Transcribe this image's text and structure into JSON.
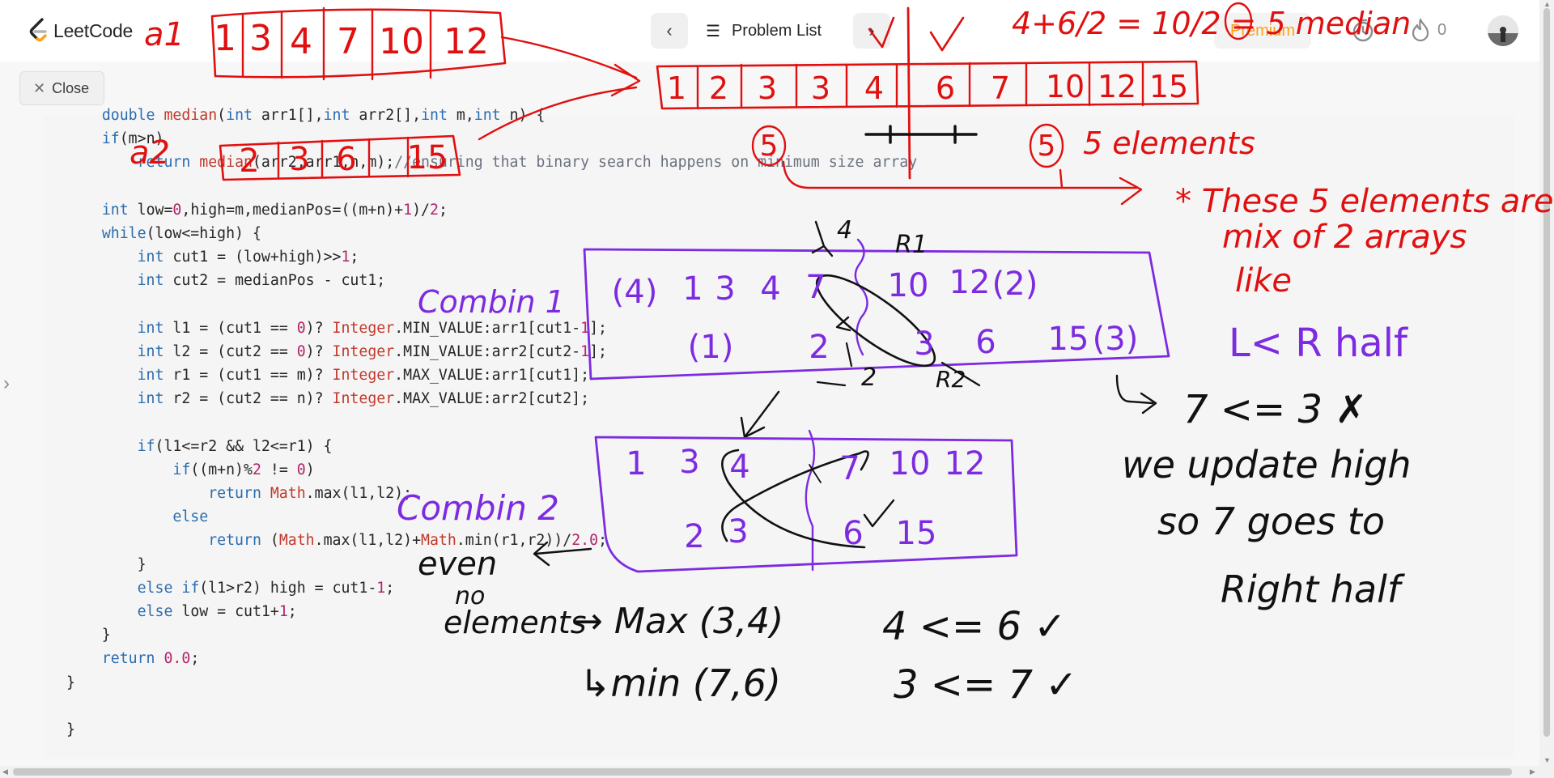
{
  "brand": {
    "name": "LeetCode"
  },
  "nav": {
    "prev_label": "‹",
    "problem_list_label": "Problem List",
    "next_label": "›",
    "premium_label": "Premium",
    "streak_count": "0"
  },
  "subbar": {
    "close_label": "Close"
  },
  "code_lines": [
    "    double median(int arr1[],int arr2[],int m,int n) {",
    "    if(m>n)",
    "        return median(arr2,arr1,n,m);//ensuring that binary search happens on minimum size array",
    "",
    "    int low=0,high=m,medianPos=((m+n)+1)/2;",
    "    while(low<=high) {",
    "        int cut1 = (low+high)>>1;",
    "        int cut2 = medianPos - cut1;",
    "",
    "        int l1 = (cut1 == 0)? Integer.MIN_VALUE:arr1[cut1-1];",
    "        int l2 = (cut2 == 0)? Integer.MIN_VALUE:arr2[cut2-1];",
    "        int r1 = (cut1 == m)? Integer.MAX_VALUE:arr1[cut1];",
    "        int r2 = (cut2 == n)? Integer.MAX_VALUE:arr2[cut2];",
    "",
    "        if(l1<=r2 && l2<=r1) {",
    "            if((m+n)%2 != 0)",
    "                return Math.max(l1,l2);",
    "            else",
    "                return (Math.max(l1,l2)+Math.min(r1,r2))/2.0;",
    "        }",
    "        else if(l1>r2) high = cut1-1;",
    "        else low = cut1+1;",
    "    }",
    "    return 0.0;",
    "}",
    "",
    "}"
  ],
  "annotations": {
    "array1_label": "a1",
    "array1": [
      "1",
      "3",
      "4",
      "7",
      "10",
      "12"
    ],
    "array2_label": "a2",
    "array2": [
      "2",
      "3",
      "6",
      "15"
    ],
    "merged": [
      "1",
      "2",
      "3",
      "3",
      "4",
      "6",
      "7",
      "10",
      "12",
      "15"
    ],
    "median_formula": "4+6/2 = 10/2 = 5 median",
    "median_mark": "5",
    "five_elements": "5 elements",
    "note1": "* These 5 elements are",
    "note2": "mix of 2 arrays",
    "note3": "like",
    "note4": "L< R half",
    "combin1_label": "Combin 1",
    "combin1_row1": [
      "(4)",
      "1",
      "3",
      "4",
      "7",
      "10",
      "12",
      "(2)"
    ],
    "combin1_row2": [
      "(1)",
      "2",
      "3",
      "6",
      "15",
      "(3)"
    ],
    "l1_mark": "4",
    "r1_mark": "R1",
    "l2_mark": "2",
    "r2_mark": "R2",
    "compare_fail": "7 <= 3 ✗",
    "update1": "we update high",
    "update2": "so 7 goes to",
    "update3": "Right half",
    "combin2_label": "Combin 2",
    "combin2_row1": [
      "1",
      "3",
      "4",
      "7",
      "10",
      "12"
    ],
    "combin2_row2": [
      "2",
      "3",
      "6",
      "15"
    ],
    "even_label": "even",
    "no_label": "no",
    "elements_label": "elements",
    "max_expr": "→ Max (3,4)",
    "min_expr": "↳min (7,6)",
    "check1": "4 <= 6 ✓",
    "check2": "3 <= 7 ✓"
  }
}
